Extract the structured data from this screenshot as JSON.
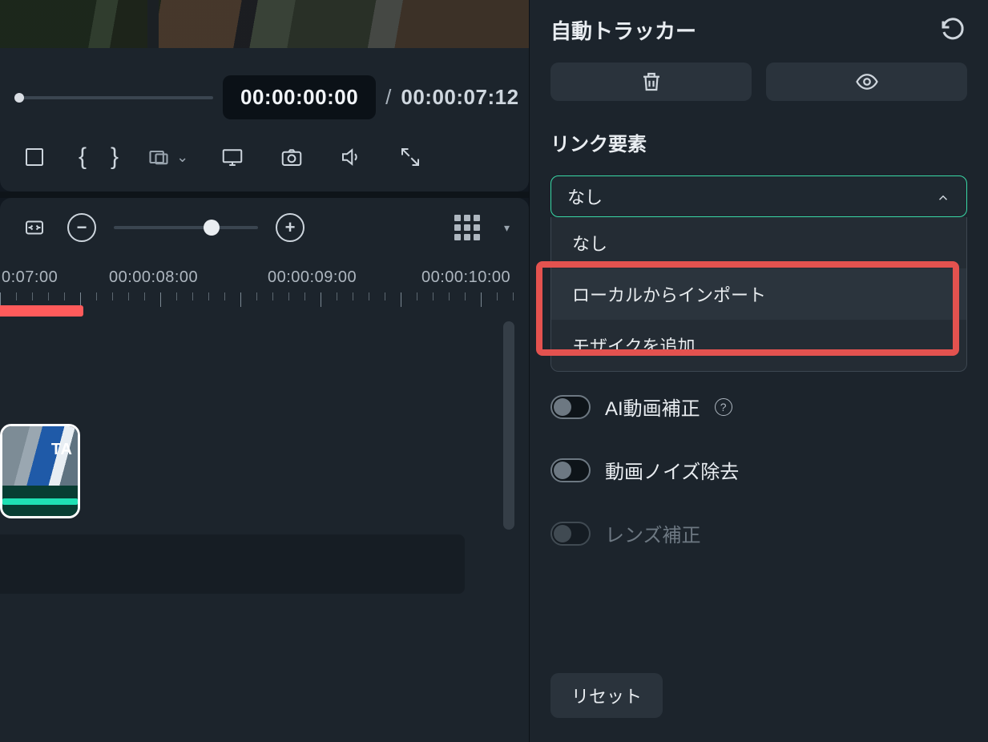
{
  "playbar": {
    "current_tc": "00:00:00:00",
    "separator": "/",
    "total_tc": "00:00:07:12"
  },
  "ruler_labels": [
    "0:07:00",
    "00:00:08:00",
    "00:00:09:00",
    "00:00:10:00"
  ],
  "clip": {
    "badge": "TA"
  },
  "panel": {
    "title": "自動トラッカー",
    "link_label": "リンク要素",
    "select_value": "なし",
    "options": [
      "なし",
      "ローカルからインポート",
      "モザイクを追加"
    ],
    "highlighted_option_index": 1,
    "ai_label": "AI動画補正",
    "noise_label": "動画ノイズ除去",
    "lens_label": "レンズ補正",
    "reset_label": "リセット"
  },
  "icons": {
    "stop": "stop",
    "brace_open": "{",
    "brace_close": "}",
    "plus": "+",
    "minus": "−"
  }
}
